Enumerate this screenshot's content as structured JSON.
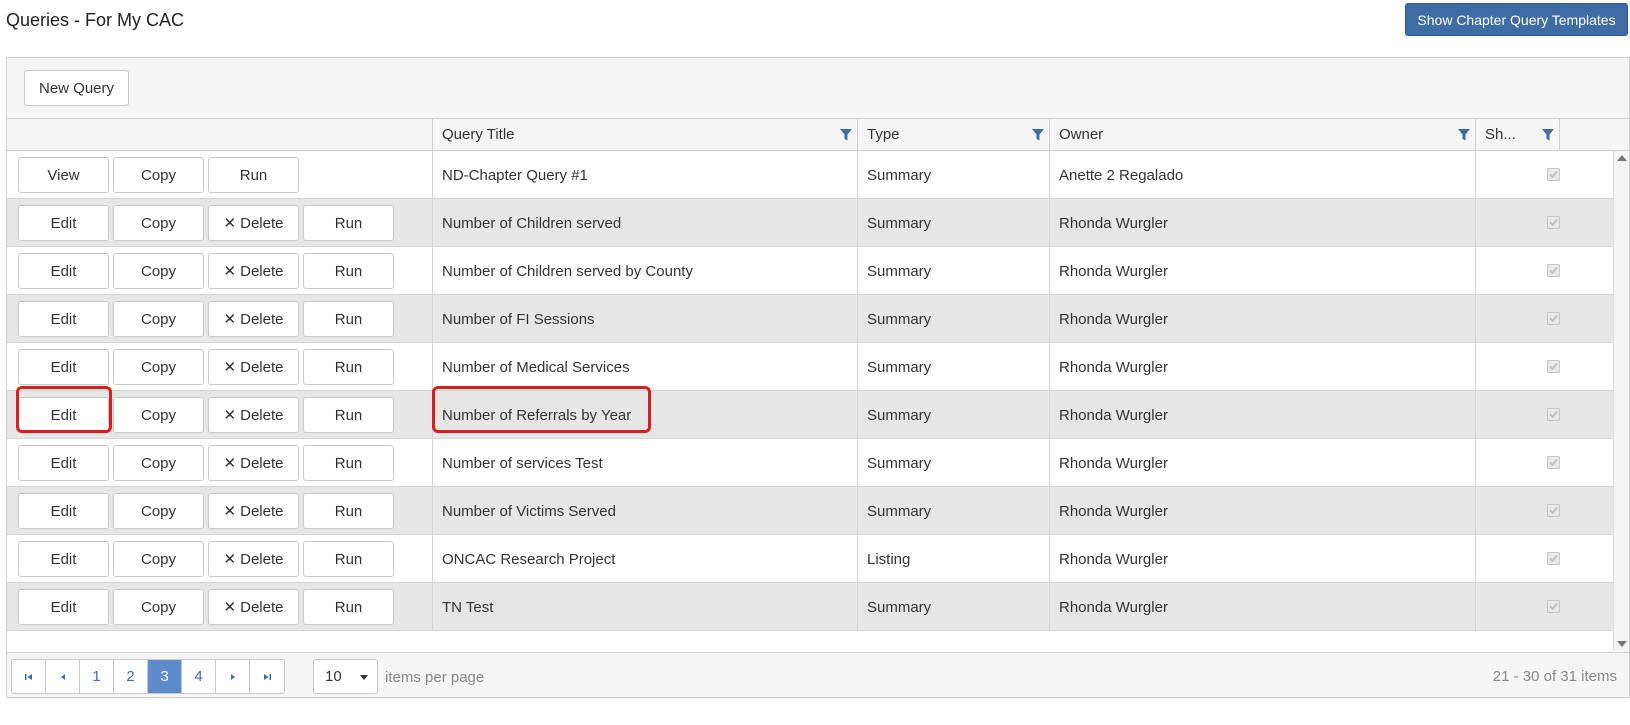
{
  "page": {
    "title": "Queries - For My CAC",
    "templates_button": "Show Chapter Query Templates"
  },
  "toolbar": {
    "new_query_label": "New Query"
  },
  "columns": {
    "title": "Query Title",
    "type": "Type",
    "owner": "Owner",
    "shared": "Sh..."
  },
  "buttons": {
    "view": "View",
    "edit": "Edit",
    "copy": "Copy",
    "delete": "Delete",
    "run": "Run"
  },
  "rows": [
    {
      "title": "ND-Chapter Query #1",
      "type": "Summary",
      "owner": "Anette 2 Regalado",
      "shared": true,
      "editable": false
    },
    {
      "title": "Number of Children served",
      "type": "Summary",
      "owner": "Rhonda Wurgler",
      "shared": true,
      "editable": true
    },
    {
      "title": "Number of Children served by County",
      "type": "Summary",
      "owner": "Rhonda Wurgler",
      "shared": true,
      "editable": true
    },
    {
      "title": "Number of FI Sessions",
      "type": "Summary",
      "owner": "Rhonda Wurgler",
      "shared": true,
      "editable": true
    },
    {
      "title": "Number of Medical Services",
      "type": "Summary",
      "owner": "Rhonda Wurgler",
      "shared": true,
      "editable": true
    },
    {
      "title": "Number of Referrals by Year",
      "type": "Summary",
      "owner": "Rhonda Wurgler",
      "shared": true,
      "editable": true
    },
    {
      "title": "Number of services Test",
      "type": "Summary",
      "owner": "Rhonda Wurgler",
      "shared": true,
      "editable": true
    },
    {
      "title": "Number of Victims Served",
      "type": "Summary",
      "owner": "Rhonda Wurgler",
      "shared": true,
      "editable": true
    },
    {
      "title": "ONCAC Research Project",
      "type": "Listing",
      "owner": "Rhonda Wurgler",
      "shared": true,
      "editable": true
    },
    {
      "title": "TN Test",
      "type": "Summary",
      "owner": "Rhonda Wurgler",
      "shared": true,
      "editable": true
    }
  ],
  "pager": {
    "pages": [
      "1",
      "2",
      "3",
      "4"
    ],
    "current_page": "3",
    "per_page": "10",
    "per_page_label": "items per page",
    "info": "21 - 30 of 31 items"
  },
  "colors": {
    "primary": "#3f6ca5",
    "active_page": "#5f8bcc",
    "highlight": "#d61f1f",
    "alt_row": "#e6e6e6"
  }
}
